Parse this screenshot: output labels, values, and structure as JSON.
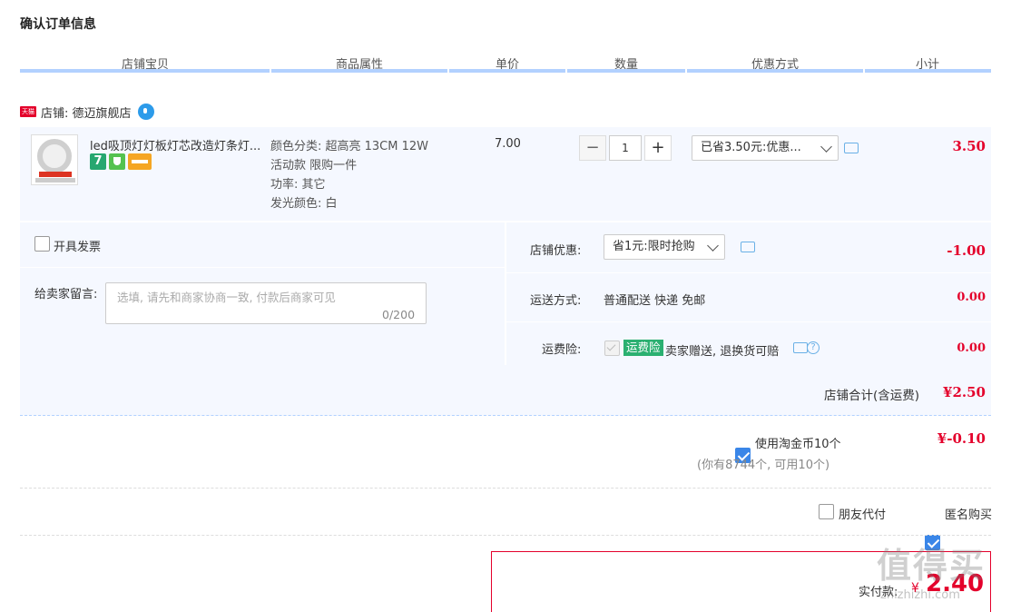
{
  "page": {
    "title": "确认订单信息"
  },
  "columns": [
    "店铺宝贝",
    "商品属性",
    "单价",
    "数量",
    "优惠方式",
    "小计"
  ],
  "shop": {
    "badge": "天猫",
    "name": "店铺: 德迈旗舰店"
  },
  "item": {
    "title": "led吸顶灯灯板灯芯改造灯条灯...",
    "badge_7": "7",
    "attributes": [
      "颜色分类: 超高亮 13CM 12W",
      "活动款 限购一件",
      "功率: 其它",
      "发光颜色: 白"
    ],
    "unit_price": "7.00",
    "quantity": "1",
    "qty_minus": "−",
    "qty_plus": "+",
    "discount_select": "已省3.50元:优惠...",
    "subtotal": "3.50"
  },
  "options": {
    "invoice_label": "开具发票",
    "memo_label": "给卖家留言:",
    "memo_placeholder": "选填, 请先和商家协商一致, 付款后商家可见",
    "memo_count": "0/200",
    "shop_discount_label": "店铺优惠:",
    "shop_discount_select": "省1元:限时抢购",
    "shop_discount_amount": "-1.00",
    "shipping_label": "运送方式:",
    "shipping_value": "普通配送 快递 免邮",
    "shipping_amount": "0.00",
    "insurance_label": "运费险:",
    "insurance_tag": "运费险",
    "insurance_text": "卖家赠送, 退换货可赔",
    "insurance_amount": "0.00",
    "help_glyph": "?"
  },
  "shop_total": {
    "label": "店铺合计(含运费)",
    "amount": "¥2.50"
  },
  "coins": {
    "label": "使用淘金币10个",
    "note": "(你有8744个, 可用10个)",
    "amount": "¥-0.10"
  },
  "extras": {
    "friend_pay": "朋友代付",
    "anonymous": "匿名购买"
  },
  "payment": {
    "label": "实付款:",
    "currency": "¥",
    "amount": "2.40"
  },
  "watermark": {
    "text": "值得买",
    "url": "zhizhizhi.com"
  },
  "colors": {
    "accent_blue": "#b2d1ff",
    "price_red": "#e4002b",
    "row_bg": "#f5f8ff",
    "check_blue": "#3a86e8"
  }
}
